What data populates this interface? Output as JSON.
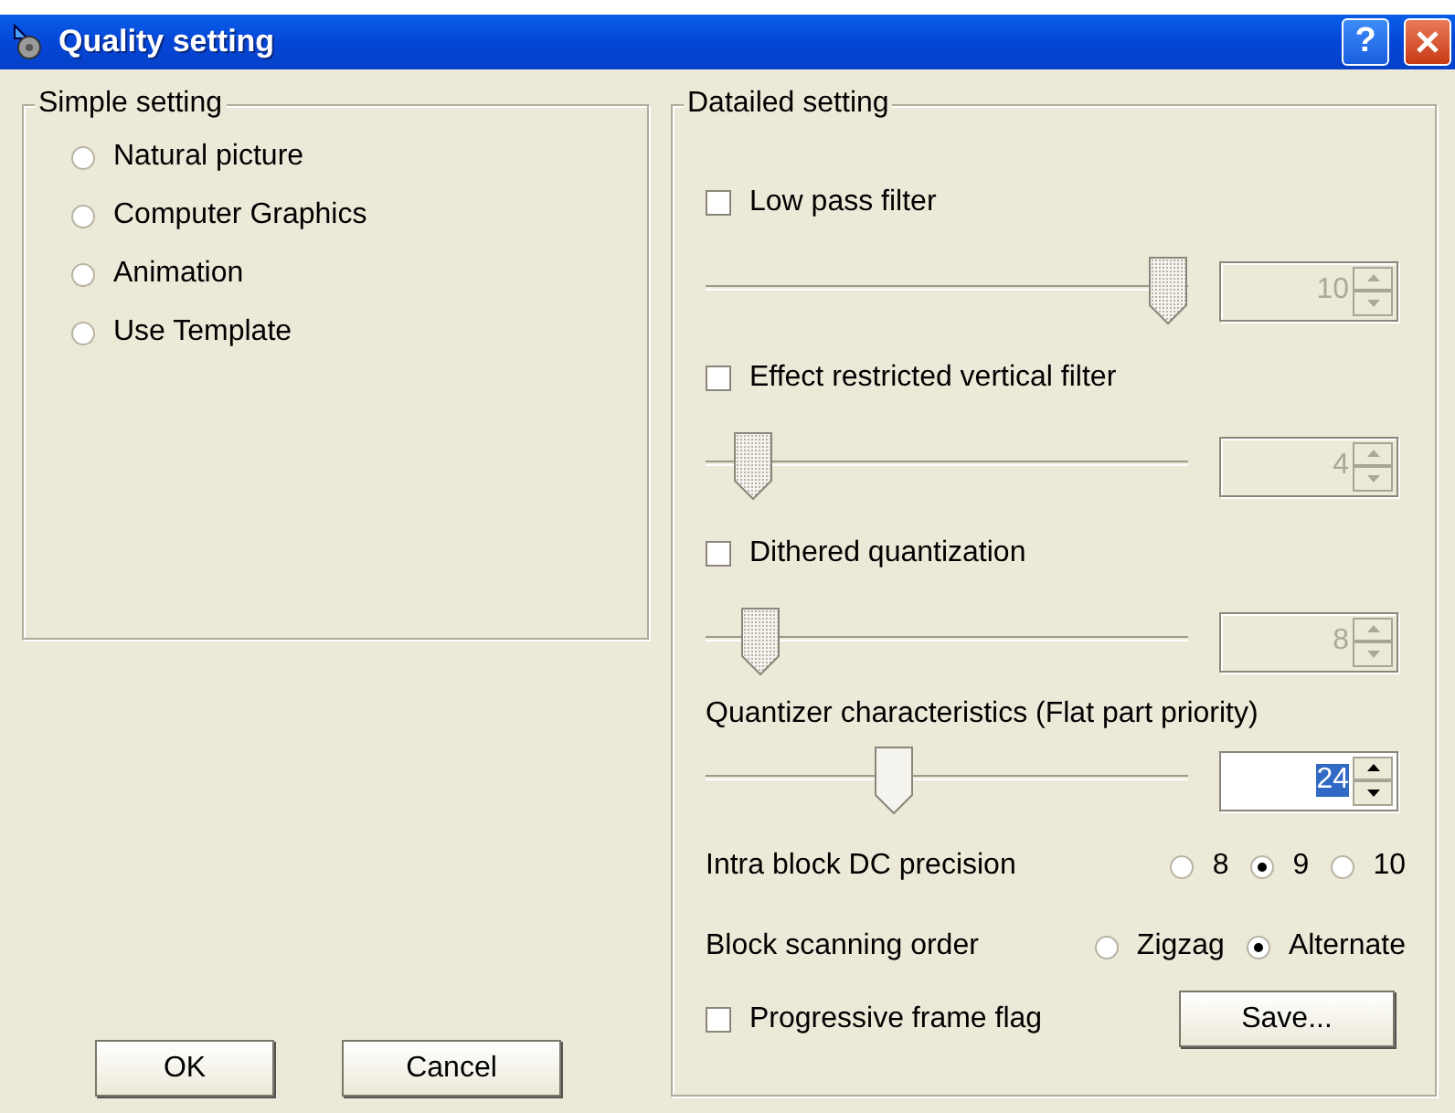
{
  "window": {
    "title": "Quality setting",
    "help_button": "?"
  },
  "simple_setting": {
    "title": "Simple setting",
    "options": [
      {
        "label": "Natural picture",
        "selected": false
      },
      {
        "label": "Computer Graphics",
        "selected": false
      },
      {
        "label": "Animation",
        "selected": false
      },
      {
        "label": "Use Template",
        "selected": false
      }
    ]
  },
  "detailed_setting": {
    "title": "Datailed setting",
    "items": [
      {
        "kind": "checkbox",
        "label": "Low pass filter",
        "checked": false
      },
      {
        "kind": "slider",
        "level": 1.0,
        "disabled": true,
        "value": "10",
        "value_selected": false
      },
      {
        "kind": "checkbox",
        "label": "Effect restricted vertical filter",
        "checked": false
      },
      {
        "kind": "slider",
        "level": 0.06,
        "disabled": true,
        "value": "4",
        "value_selected": false
      },
      {
        "kind": "checkbox",
        "label": "Dithered quantization",
        "checked": false
      },
      {
        "kind": "slider",
        "level": 0.08,
        "disabled": true,
        "value": "8",
        "value_selected": false
      },
      {
        "kind": "label",
        "label": "Quantizer characteristics (Flat part priority)"
      },
      {
        "kind": "slider",
        "level": 0.38,
        "disabled": false,
        "value": "24",
        "value_selected": true
      },
      {
        "kind": "radios",
        "label": "Intra block DC precision",
        "options": [
          {
            "label": "8",
            "selected": false
          },
          {
            "label": "9",
            "selected": true
          },
          {
            "label": "10",
            "selected": false
          }
        ]
      },
      {
        "kind": "radios",
        "label": "Block scanning order",
        "options": [
          {
            "label": "Zigzag",
            "selected": false
          },
          {
            "label": "Alternate",
            "selected": true
          }
        ]
      },
      {
        "kind": "checkbox-button",
        "label": "Progressive frame flag",
        "checked": false,
        "button": "Save..."
      }
    ]
  },
  "buttons": [
    "OK",
    "Cancel"
  ]
}
